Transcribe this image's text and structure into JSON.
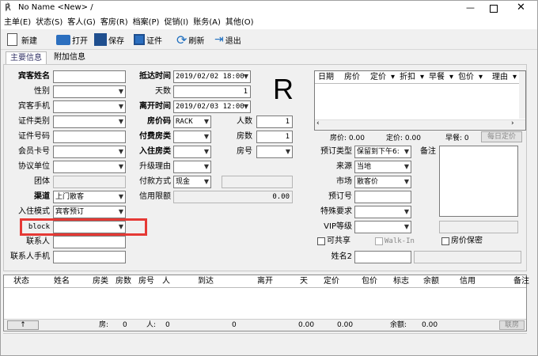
{
  "window": {
    "title": "No Name <New> /"
  },
  "menu": [
    "主单(E)",
    "状态(S)",
    "客人(G)",
    "客房(R)",
    "档案(P)",
    "促销(I)",
    "账务(A)",
    "其他(O)"
  ],
  "toolbar": {
    "new": "新建",
    "open": "打开",
    "save": "保存",
    "cert": "证件",
    "refresh": "刷新",
    "exit": "退出"
  },
  "tabs": {
    "main": "主要信息",
    "extra": "附加信息"
  },
  "form": {
    "guest_name": "宾客姓名",
    "gender": "性别",
    "mobile": "宾客手机",
    "id_type": "证件类别",
    "id_no": "证件号码",
    "member_card": "会员卡号",
    "agreement": "协议单位",
    "group": "团体",
    "channel": "渠道",
    "channel_value": "上门散客",
    "checkin_mode": "入住模式",
    "checkin_mode_value": "宾客预订",
    "block": "block",
    "contact": "联系人",
    "contact_mobile": "联系人手机",
    "arrive_label": "抵达时间",
    "arrive_value": "2019/02/02 18:00",
    "days_label": "天数",
    "days_value": "1",
    "leave_label": "离开时间",
    "leave_value": "2019/02/03 12:00",
    "rate_code_label": "房价码",
    "rate_code_value": "RACK",
    "persons_label": "人数",
    "persons_value": "1",
    "paid_room_label": "付费房类",
    "rooms_label": "房数",
    "rooms_value": "1",
    "room_type_label": "入住房类",
    "room_no_label": "房号",
    "upgrade_label": "升级理由",
    "pay_label": "付款方式",
    "pay_value": "现金",
    "credit_label": "信用限额",
    "credit_value": "0.00",
    "big_letter": "R",
    "book_type_label": "预订类型",
    "book_type_value": "保留到下午6:",
    "remark_label": "备注",
    "source_label": "来源",
    "source_value": "当地",
    "market_label": "市场",
    "market_value": "散客价",
    "book_no_label": "预订号",
    "special_label": "特殊要求",
    "vip_label": "VIP等级",
    "share_label": "可共享",
    "walkin_label": "Walk-In",
    "hide_rate_label": "房价保密",
    "name2_label": "姓名2"
  },
  "rate_grid": {
    "headers": [
      "日期",
      "房价",
      "定价",
      "折扣",
      "早餐",
      "包价",
      "理由"
    ],
    "footer": {
      "room_rate": "房价: 0.00",
      "fixed_rate": "定价: 0.00",
      "breakfast": "早餐: 0",
      "daily_btn": "每日定价"
    }
  },
  "guest_grid": {
    "headers": [
      "状态",
      "姓名",
      "房类",
      "房数",
      "房号",
      "人",
      "到达",
      "离开",
      "天",
      "定价",
      "包价",
      "标志",
      "余额",
      "信用",
      "备注"
    ],
    "footer": {
      "up_btn": "↑",
      "rooms": "房:",
      "rooms_v": "0",
      "persons": "人:",
      "persons_v": "0",
      "days_v": "0",
      "price_v": "0.00",
      "pkg_v": "0.00",
      "balance": "余额:",
      "balance_v": "0.00",
      "link_btn": "联房"
    }
  },
  "colors": {
    "highlight": "#e53935",
    "accent": "#0b4ea2"
  }
}
